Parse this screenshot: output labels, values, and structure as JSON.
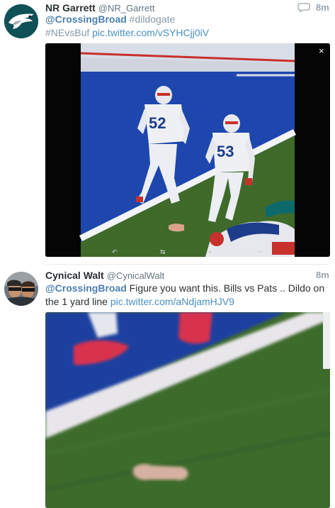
{
  "tweets": [
    {
      "name": "NR Garrett",
      "handle": "@NR_Garrett",
      "time": "8m",
      "mention": "@CrossingBroad",
      "hashtag1": "#dildogate",
      "hashtag2": "#NEvsBuf",
      "link": "pic.twitter.com/vSYHCjj0iV",
      "media_close": "×",
      "player_numbers": [
        "52",
        "53"
      ]
    },
    {
      "name": "Cynical Walt",
      "handle": "@CynicalWalt",
      "time": "8m",
      "mention": "@CrossingBroad",
      "text_line1": "Figure you want this. Bills vs Pats .. Dildo on",
      "text_line2": "the 1 yard line",
      "link": "pic.twitter.com/aNdjamHJV9"
    }
  ],
  "colors": {
    "mention": "#4a7fb0",
    "link": "#4a90c2",
    "hashtag": "#8899a6",
    "field_blue": "#1e49b0",
    "field_green": "#3f6a2a"
  },
  "icons": [
    "eagles-logo-avatar",
    "reply-icon",
    "close-icon",
    "back-icon",
    "retweet-icon",
    "heart-icon",
    "more-icon"
  ]
}
